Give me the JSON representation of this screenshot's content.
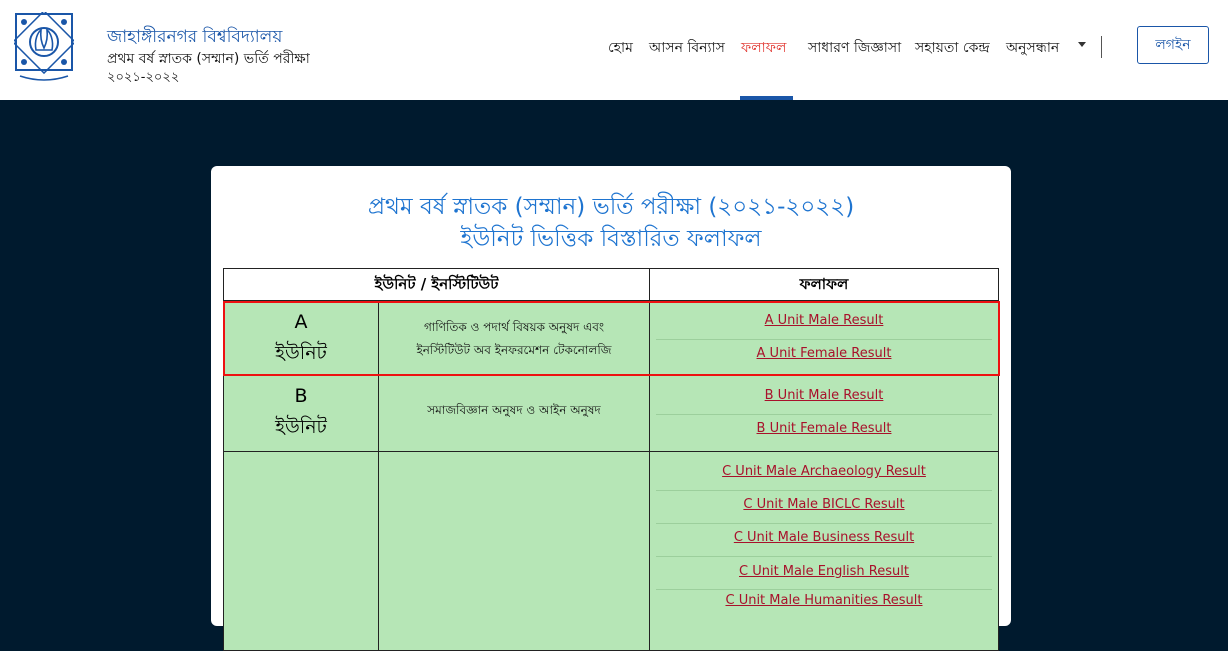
{
  "header": {
    "university": "জাহাঙ্গীরনগর বিশ্ববিদ্যালয়",
    "exam": "প্রথম বর্ষ স্নাতক (সম্মান) ভর্তি পরীক্ষা",
    "session": "২০২১-২০২২",
    "logo_icon": "university-seal-icon",
    "nav": [
      "হোম",
      "আসন বিন্যাস",
      "ফলাফল",
      "সাধারণ জিজ্ঞাসা",
      "সহায়তা কেন্দ্র",
      "অনুসন্ধান"
    ],
    "active_nav": "ফলাফল",
    "login": "লগইন"
  },
  "card": {
    "title1": "প্রথম বর্ষ স্নাতক (সম্মান) ভর্তি পরীক্ষা (২০২১-২০২২)",
    "title2": "ইউনিট ভিত্তিক বিস্তারিত ফলাফল"
  },
  "table": {
    "headers": [
      "ইউনিট / ইনস্টিটিউট",
      "ফলাফল"
    ],
    "rows": [
      {
        "letter": "A",
        "word": "ইউনিট",
        "desc_line1": "গাণিতিক ও পদার্থ বিষয়ক অনুষদ এবং",
        "desc_line2": "ইনস্টিটিউট অব ইনফরমেশন টেকনোলজি",
        "links": [
          "A Unit Male Result",
          "A Unit Female Result"
        ]
      },
      {
        "letter": "B",
        "word": "ইউনিট",
        "desc_line1": "সমাজবিজ্ঞান অনুষদ ও আইন অনুষদ",
        "links": [
          "B Unit Male Result",
          "B Unit Female Result"
        ]
      },
      {
        "links": [
          "C Unit Male Archaeology Result",
          "C Unit Male BICLC Result",
          "C Unit Male Business Result",
          "C Unit Male English Result",
          "C Unit Male Humanities Result"
        ]
      }
    ]
  },
  "colors": {
    "accent": "#1a56a8",
    "active": "#e0312b",
    "title": "#1e74d0",
    "row_bg": "#b6e6b6",
    "link": "#a8112b",
    "highlight": "#ee1111",
    "page_bg": "#001a2e"
  }
}
